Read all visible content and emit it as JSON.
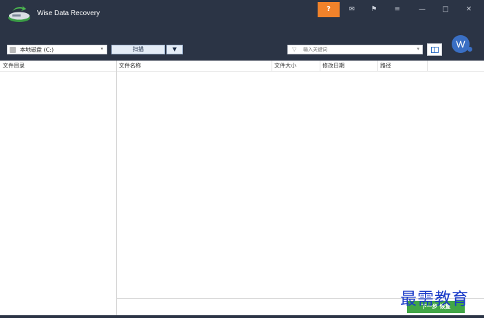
{
  "window": {
    "title": "Wise Data Recovery",
    "controls": {
      "help": "?",
      "mail": "✉",
      "flag": "⚑",
      "menu": "≡",
      "minimize": "—",
      "maximize": "□",
      "close": "✕"
    }
  },
  "toolbar": {
    "drive_value": "本地磁盘 (C:)",
    "drive_caret": "▾",
    "scan_label": "扫描",
    "scan_caret": "▼",
    "search_placeholder": "输入关键词",
    "search_caret": "▾",
    "filter_icon": "▽",
    "avatar_letter": "W"
  },
  "left_pane": {
    "header": "文件目录"
  },
  "columns": [
    "文件名称",
    "文件大小",
    "修改日期",
    "路径"
  ],
  "footer": {
    "next_label": "下一步 恢复"
  },
  "watermark": "最需教育"
}
